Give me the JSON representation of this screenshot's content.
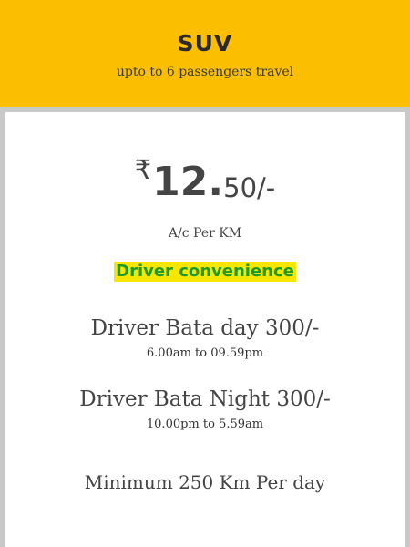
{
  "header": {
    "title": "SUV",
    "subtitle": "upto to 6 passengers travel"
  },
  "pricing": {
    "currency_symbol": "₹",
    "amount_main": "12.",
    "amount_tail": "50/-",
    "unit": "A/c Per KM"
  },
  "highlight": {
    "label": "Driver convenience"
  },
  "driver_bata_day": {
    "label": "Driver Bata day  300/-",
    "hours": "6.00am to 09.59pm"
  },
  "driver_bata_night": {
    "label": "Driver Bata Night  300/-",
    "hours": "10.00pm to 5.59am"
  },
  "minimum": {
    "label": "Minimum 250 Km Per day"
  },
  "colors": {
    "header_background": "#fbbe00",
    "card_background": "#ffffff",
    "highlight_background": "#f7e600",
    "highlight_text": "#1c9a2a"
  }
}
